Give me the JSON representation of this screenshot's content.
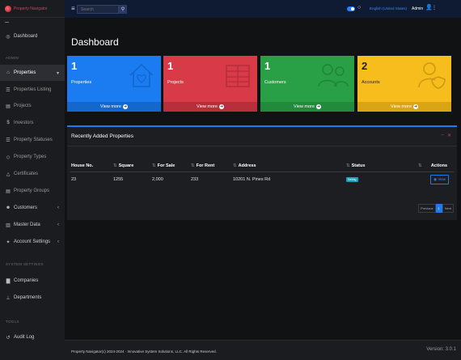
{
  "sidebar": {
    "brand": "Property Navigator",
    "items": [
      {
        "label": "Dashboard",
        "icon": "speedometer-icon"
      },
      {
        "label": "Properties",
        "icon": "home-icon"
      },
      {
        "label": "Properties Listing",
        "icon": "list-icon"
      },
      {
        "label": "Projects",
        "icon": "folder-icon"
      },
      {
        "label": "Investors",
        "icon": "dollar-icon"
      },
      {
        "label": "Property Statuses",
        "icon": "list-icon"
      },
      {
        "label": "Property Types",
        "icon": "tag-icon"
      },
      {
        "label": "Certificates",
        "icon": "certificate-icon"
      },
      {
        "label": "Property Groups",
        "icon": "list-icon"
      },
      {
        "label": "Customers",
        "icon": "users-icon"
      },
      {
        "label": "Master Data",
        "icon": "database-icon"
      },
      {
        "label": "Account Settings",
        "icon": "user-gear-icon"
      },
      {
        "label": "Companies",
        "icon": "building-icon"
      },
      {
        "label": "Departments",
        "icon": "sitemap-icon"
      },
      {
        "label": "Audit Log",
        "icon": "history-icon"
      }
    ],
    "sections": {
      "admin": "ADMIN",
      "system": "SYSTEM SETTINGS",
      "tools": "TOOLS"
    }
  },
  "topbar": {
    "search_placeholder": "Search",
    "language": "English (United States)",
    "user": "Admin"
  },
  "main": {
    "title": "Dashboard",
    "cards": [
      {
        "count": "1",
        "label": "Properties",
        "link": "View more"
      },
      {
        "count": "1",
        "label": "Projects",
        "link": "View more"
      },
      {
        "count": "1",
        "label": "Customers",
        "link": "View more"
      },
      {
        "count": "2",
        "label": "Accounts",
        "link": "View more"
      }
    ],
    "panel": {
      "title": "Recently Added Properties",
      "columns": [
        "House No.",
        "Square",
        "For Sale",
        "For Rent",
        "Address",
        "Status",
        "Actions"
      ],
      "rows": [
        {
          "house_no": "23",
          "square": "1255",
          "for_sale": "2,000",
          "for_rent": "233",
          "address": "10201 N. Pines Rd",
          "status": "Selling",
          "action": "View"
        }
      ],
      "pager": {
        "previous": "Previous",
        "page": "1",
        "next": "Next"
      }
    }
  },
  "footer": {
    "copyright": "Property Navigator(c) 2024-2024 · Innovative System Solutions, LLC. All Rights Reserved.",
    "version": "Version: 3.0.1"
  },
  "colors": {
    "blue": "#1a7cf0",
    "red": "#d93a48",
    "green": "#29a046",
    "yellow": "#f7bd1d"
  }
}
